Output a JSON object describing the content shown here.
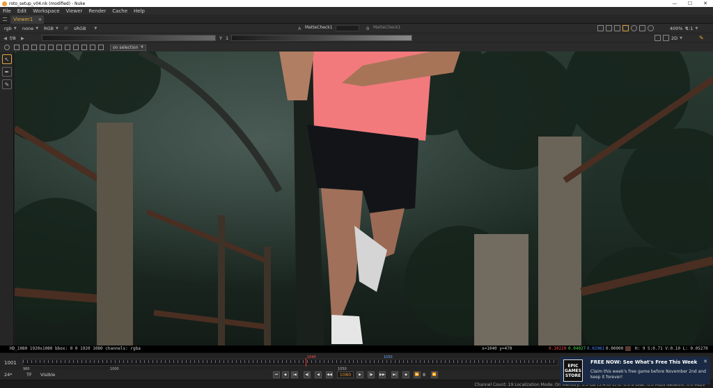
{
  "window": {
    "title": "roto_setup_v04.nk (modified) - Nuke",
    "minimize": "—",
    "maximize": "☐",
    "close": "✕"
  },
  "menu": [
    "File",
    "Edit",
    "Workspace",
    "Viewer",
    "Render",
    "Cache",
    "Help"
  ],
  "tab": {
    "label": "Viewer1",
    "close": "✕"
  },
  "viewer_controls": {
    "channels": "rgb",
    "mask": "none",
    "display": "RGB",
    "ip_label": "IP",
    "lut": "sRGB",
    "input_a_label": "A",
    "input_a": "MatteCheck1",
    "input_b_label": "B",
    "input_b": "MatteCheck1",
    "zoom": "400%",
    "ratio": "1:1",
    "mode": "2D"
  },
  "exposure": {
    "fstop": "f/8",
    "gamma_label": "Y",
    "gamma": "1"
  },
  "selection_mode": "on selection",
  "info": {
    "format": "HD_1080 1920x1080  bbox: 0 0 1920 1080 channels: rgba",
    "coords": "x=1040 y=470",
    "r": "0.10229",
    "g": "0.04027",
    "b": "0.02981",
    "a": "0.00000",
    "hsvl": "H: 9 S:0.71 V:0.10  L: 0.05270"
  },
  "timeline": {
    "in_frame": "1001",
    "labels": [
      "980",
      "1000",
      "1050"
    ],
    "marker": "1040",
    "marker2": "1050"
  },
  "playback": {
    "fps": "24*",
    "tf": "TF",
    "visible": "Visible",
    "current_frame": "1080",
    "increment": "8"
  },
  "status": "Channel Count: 19  Localization Mode: On  Memory: 3.5 GB (3.4%)  CPU: 0.0%  Disk: 0.0 MB/s  Network: 0.0 MB/s",
  "toast": {
    "logo": "EPIC GAMES STORE",
    "heading": "FREE NOW: See What's Free This Week",
    "body": "Claim this week's free game before November 2nd and keep it forever!",
    "close": "✕"
  },
  "colors": {
    "accent": "#e0a840",
    "panel": "#2b2b2b",
    "toast_bg": "#1a2a44"
  }
}
